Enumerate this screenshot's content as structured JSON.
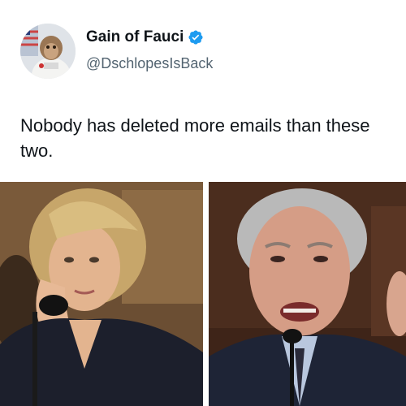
{
  "tweet": {
    "display_name": "Gain of Fauci",
    "handle": "@DschlopesIsBack",
    "verified": true,
    "verified_icon": "verified-badge-icon",
    "text": "Nobody has deleted more emails than these two."
  },
  "media": {
    "images": [
      {
        "icon": "photo-left-image"
      },
      {
        "icon": "photo-right-image"
      }
    ]
  },
  "colors": {
    "name": "#0f1419",
    "handle": "#536471",
    "verified": "#1d9bf0",
    "background": "#ffffff"
  }
}
